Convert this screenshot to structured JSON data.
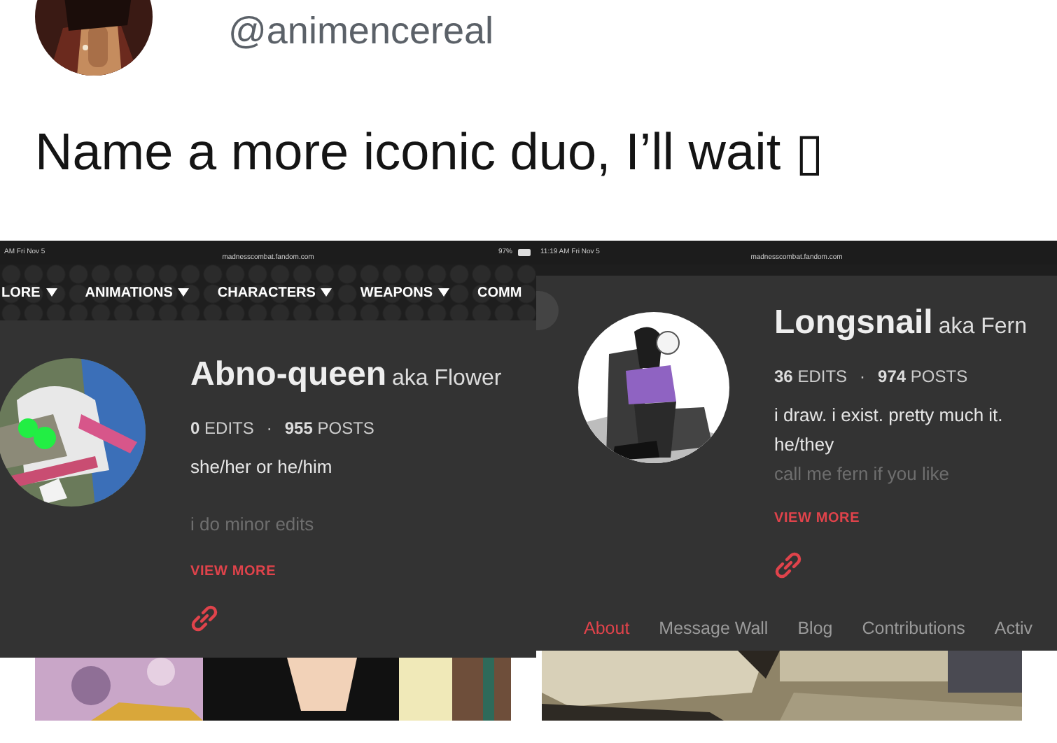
{
  "tweet": {
    "handle": "@animencereal",
    "text": "Name a more iconic duo, I’ll wait ▯"
  },
  "screenshots": [
    {
      "status_bar": {
        "time": "AM  Fri Nov 5",
        "url": "madnesscombat.fandom.com",
        "battery": "97%"
      },
      "nav": [
        {
          "label": "LORE",
          "dropdown": true
        },
        {
          "label": "ANIMATIONS",
          "dropdown": true
        },
        {
          "label": "CHARACTERS",
          "dropdown": true
        },
        {
          "label": "WEAPONS",
          "dropdown": true
        },
        {
          "label": "COMM",
          "dropdown": false
        }
      ],
      "profile": {
        "name": "Abno-queen",
        "aka": "aka Flower",
        "edits_count": "0",
        "edits_label": "EDITS",
        "separator": "·",
        "posts_count": "955",
        "posts_label": "POSTS",
        "bio": [
          {
            "text": "she/her or he/him",
            "faded": false
          },
          {
            "text": "i do minor edits",
            "faded": true
          }
        ],
        "view_more": "VIEW MORE"
      }
    },
    {
      "status_bar": {
        "time": "11:19 AM  Fri Nov 5",
        "url": "madnesscombat.fandom.com"
      },
      "profile": {
        "name": "Longsnail",
        "aka": "aka Fern",
        "edits_count": "36",
        "edits_label": "EDITS",
        "separator": "·",
        "posts_count": "974",
        "posts_label": "POSTS",
        "bio": [
          {
            "text": "i draw. i exist. pretty much it.",
            "faded": false
          },
          {
            "text": "he/they",
            "faded": false
          },
          {
            "text": "call me fern if you like",
            "faded": true
          }
        ],
        "view_more": "VIEW MORE"
      },
      "tabs": [
        {
          "label": "About",
          "selected": true
        },
        {
          "label": "Message Wall",
          "selected": false
        },
        {
          "label": "Blog",
          "selected": false
        },
        {
          "label": "Contributions",
          "selected": false
        },
        {
          "label": "Activ",
          "selected": false
        }
      ]
    }
  ]
}
